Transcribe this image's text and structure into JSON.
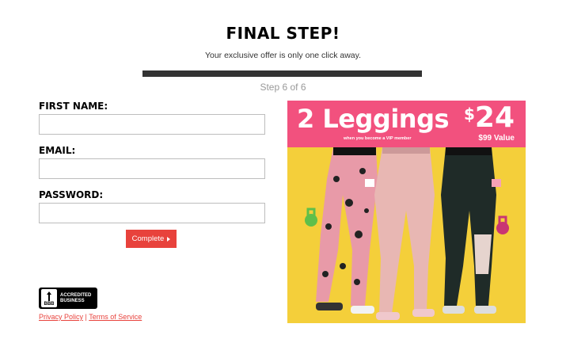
{
  "header": {
    "title": "FINAL STEP!",
    "subtitle": "Your exclusive offer is only one click away.",
    "step": "Step 6 of 6",
    "progress": 1.0
  },
  "form": {
    "first_name_label": "FIRST NAME:",
    "first_name_value": "",
    "email_label": "EMAIL:",
    "email_value": "",
    "password_label": "PASSWORD:",
    "password_value": "",
    "complete_label": "Complete"
  },
  "badge": {
    "seal_text": "BBB",
    "line1": "ACCREDITED",
    "line2": "BUSINESS"
  },
  "footer": {
    "privacy": "Privacy Policy",
    "separator": "|",
    "terms": "Terms of Service"
  },
  "promo": {
    "headline": "2 Leggings",
    "currency": "$",
    "price": "24",
    "vip_note": "when you become a VIP member",
    "value_note": "$99 Value",
    "image_icon": "leggings-models-photo"
  },
  "colors": {
    "accent": "#e8423c",
    "banner": "#f2517e",
    "background_photo": "#f4cf3a",
    "progress": "#333333"
  }
}
